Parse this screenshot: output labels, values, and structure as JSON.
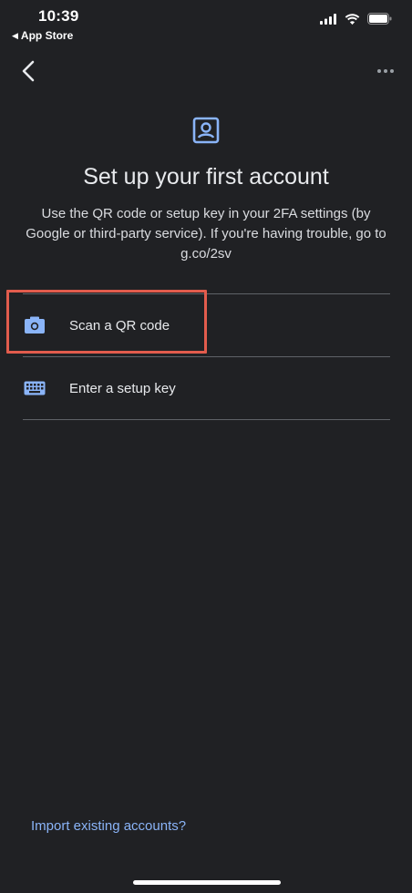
{
  "status_bar": {
    "time": "10:39",
    "back_app": "App Store"
  },
  "header": {
    "back_icon": "chevron-left-icon",
    "more_icon": "more-horizontal-icon"
  },
  "hero": {
    "icon": "account-box-icon",
    "title": "Set up your first account",
    "description": "Use the QR code or setup key in your 2FA settings (by Google or third-party service). If you're having trouble, go to g.co/2sv"
  },
  "options": [
    {
      "icon": "camera-icon",
      "label": "Scan a QR code"
    },
    {
      "icon": "keyboard-icon",
      "label": "Enter a setup key"
    }
  ],
  "footer": {
    "import_label": "Import existing accounts?"
  },
  "colors": {
    "background": "#202124",
    "accent": "#8ab4f8",
    "highlight": "#e25c4d",
    "divider": "#5f6368",
    "text": "#e8eaed"
  }
}
